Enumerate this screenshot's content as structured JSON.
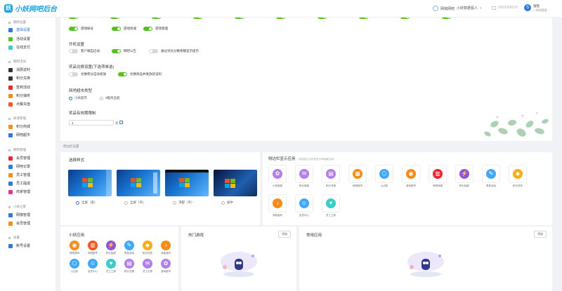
{
  "header": {
    "logo_text": "小妖网吧后台",
    "items": [
      "网咖网吧",
      "小妖数据看人",
      "9969988008"
    ],
    "user_name": "张程",
    "user_role": "> 网吧管理",
    "avatar_letter": "S"
  },
  "sidebar": {
    "groups": [
      {
        "title": "网吧设置",
        "items": [
          {
            "label": "基础设置",
            "color": "#2a7ae2",
            "active": true
          },
          {
            "label": "活动设置",
            "color": "#52c41a"
          },
          {
            "label": "在线支付",
            "color": "#36cfc9"
          }
        ]
      },
      {
        "title": "网吧活动",
        "items": [
          {
            "label": "消费返利",
            "color": "#333"
          },
          {
            "label": "积分兑换",
            "color": "#333"
          },
          {
            "label": "签到活动",
            "color": "#f5222d"
          },
          {
            "label": "积分抽奖",
            "color": "#fa8c16"
          },
          {
            "label": "点餐充值",
            "color": "#fa541c"
          }
        ]
      },
      {
        "title": "商城管理",
        "items": [
          {
            "label": "积分商城",
            "color": "#fa8c16"
          },
          {
            "label": "网吧超市",
            "color": "#2a7ae2"
          }
        ]
      },
      {
        "title": "网吧管理",
        "items": [
          {
            "label": "会员管理",
            "color": "#f5222d"
          },
          {
            "label": "网吧记录",
            "color": "#2a7ae2"
          },
          {
            "label": "员工管理",
            "color": "#fa8c16"
          },
          {
            "label": "员工提成",
            "color": "#2a7ae2"
          },
          {
            "label": "商家管理",
            "color": "#eb2f96"
          }
        ]
      },
      {
        "title": "小妖之家",
        "items": [
          {
            "label": "网咖管理",
            "color": "#2a7ae2"
          },
          {
            "label": "会员管理",
            "color": "#fa8c16"
          }
        ]
      },
      {
        "title": "设置",
        "items": [
          {
            "label": "账号设置",
            "color": "#2a7ae2"
          }
        ]
      }
    ]
  },
  "top_toggles": [
    {
      "label": "游戏帐号",
      "on": true
    },
    {
      "label": "游戏商城",
      "on": true
    },
    {
      "label": "游戏管理",
      "on": true
    }
  ],
  "boot": {
    "title": "开机设置",
    "toggles": [
      {
        "label": "客户端自启动",
        "on": false
      },
      {
        "label": "网吧公告",
        "on": true
      },
      {
        "label": "通过对比分数余额显示提示",
        "on": false
      }
    ]
  },
  "reward": {
    "title": "奖品兑换设置(下选项单选)",
    "toggles": [
      {
        "label": "兑换积分自动发放",
        "on": false
      },
      {
        "label": "兑换商品并发放验证码",
        "on": true
      }
    ]
  },
  "market": {
    "title": "网吧超市类型",
    "options": [
      {
        "label": "小妖超市",
        "on": true
      },
      {
        "label": "0酷商品超",
        "on": false
      }
    ]
  },
  "expire": {
    "title": "奖品有效期限制",
    "value": "1",
    "unit": "天"
  },
  "sidebar_setting_label": "侧边栏设置",
  "style": {
    "title": "选择样式",
    "options": [
      {
        "label": "全屏（宽）",
        "on": true
      },
      {
        "label": "全屏（窄）",
        "on": false
      },
      {
        "label": "顶部（窄）",
        "on": false
      },
      {
        "label": "居中",
        "on": false
      }
    ]
  },
  "side_apps": {
    "title": "侧边栏显示应用",
    "hint": "(请按钮点击标签显示和隐藏应用)",
    "items": [
      {
        "label": "小妖商城",
        "color": "#b37feb",
        "glyph": "✿"
      },
      {
        "label": "积分商城",
        "color": "#b37feb",
        "glyph": "✉"
      },
      {
        "label": "积分兑换",
        "color": "#b37feb",
        "glyph": "▤"
      },
      {
        "label": "网吧超市",
        "color": "#fa8c16",
        "glyph": "▦"
      },
      {
        "label": "六边形",
        "color": "#40a9ff",
        "glyph": "⬡"
      },
      {
        "label": "游戏超市",
        "color": "#fa8c16",
        "glyph": "◉"
      },
      {
        "label": "网吧商城",
        "color": "#f5222d",
        "glyph": "▥"
      },
      {
        "label": "积分抽奖",
        "color": "#9254de",
        "glyph": "⚡"
      },
      {
        "label": "签到活动",
        "color": "#40a9ff",
        "glyph": "✎"
      },
      {
        "label": "积分任务",
        "color": "#faad14",
        "glyph": "◆"
      },
      {
        "label": "消费返利",
        "color": "#fa8c16",
        "glyph": "♪"
      },
      {
        "label": "会员中心",
        "color": "#40a9ff",
        "glyph": "☺"
      },
      {
        "label": "员工之家",
        "color": "#36cfc9",
        "glyph": "♥"
      }
    ]
  },
  "small_apps": {
    "title": "小妖应用",
    "items": [
      {
        "label": "网吧游戏",
        "color": "#fa8c16",
        "glyph": "◉"
      },
      {
        "label": "网吧超市",
        "color": "#fa541c",
        "glyph": "▥"
      },
      {
        "label": "积分抽奖",
        "color": "#9254de",
        "glyph": "⚡"
      },
      {
        "label": "签到活动",
        "color": "#40a9ff",
        "glyph": "✎"
      },
      {
        "label": "积分任务",
        "color": "#faad14",
        "glyph": "◆"
      },
      {
        "label": "消费返利",
        "color": "#fa8c16",
        "glyph": "♪"
      },
      {
        "label": "六边形",
        "color": "#40a9ff",
        "glyph": "⬡"
      },
      {
        "label": "会员中心",
        "color": "#40a9ff",
        "glyph": "☺"
      },
      {
        "label": "员工之家",
        "color": "#36cfc9",
        "glyph": "♥"
      },
      {
        "label": "积分兑换",
        "color": "#b37feb",
        "glyph": "▤"
      },
      {
        "label": "员工记录",
        "color": "#b37feb",
        "glyph": "✉"
      },
      {
        "label": "游戏超市",
        "color": "#b37feb",
        "glyph": "✿"
      }
    ]
  },
  "hot_games": {
    "title": "热门游戏",
    "add": "添加"
  },
  "common_apps": {
    "title": "常用应用",
    "add": "添加"
  }
}
